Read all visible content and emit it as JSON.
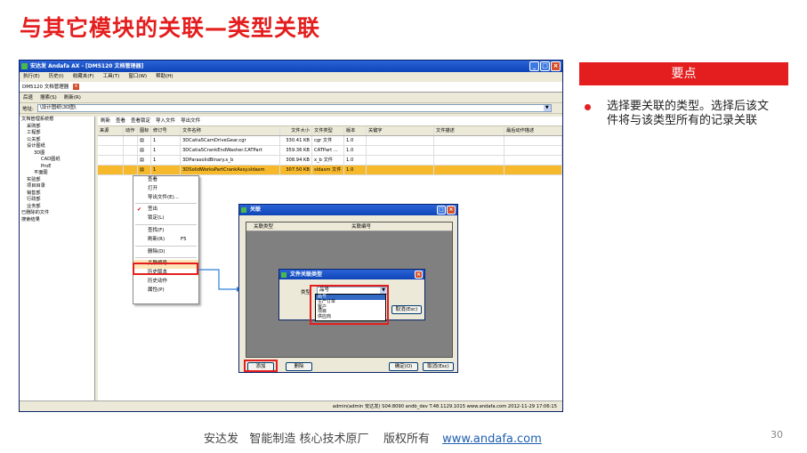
{
  "slide": {
    "title": "与其它模块的关联—类型关联",
    "key_header": "要点",
    "key_text": "选择要关联的类型。选择后该文件将与该类型所有的记录关联",
    "footer": "安达发   智能制造 核心技术原厂    版权所有",
    "footer_link": "www.andafa.com",
    "page_number": "30",
    "accent_color": "#e41e1e"
  },
  "window": {
    "title": "安达发 Andafa AX - [DM5120 文档管理器]",
    "menu": [
      "执行(E)",
      "历史(I)",
      "收藏夹(F)",
      "工具(T)",
      "窗口(W)",
      "帮助(H)"
    ],
    "doc_tab": "DM5120 文档管理器",
    "toolbar": [
      "后退",
      "搜索(S)",
      "刷新(R)"
    ],
    "address_label": "地址:",
    "address_value": "\\设计图纸\\3D图\\",
    "tree": [
      "文档管理系统根",
      "采购部",
      "工程部",
      "公关部",
      "设计图纸",
      "3D图",
      "CAD图纸",
      "ProE",
      "平面图",
      "实验部",
      "项目目录",
      "销售部",
      "行政部",
      "业务部",
      "已删除的文件",
      "搜索结果"
    ],
    "grid_toolbar": [
      "刷新",
      "查看",
      "查看锁定",
      "导入文件",
      "导出文件"
    ],
    "columns": [
      "来源",
      "动作",
      "图标",
      "修订号",
      "文件名称",
      "文件大小",
      "文件类型",
      "版本",
      "关键字",
      "文件描述",
      "最后动作描述"
    ],
    "rows": [
      {
        "rev": "1",
        "name": "3DCatia5CamDriveGear.cgr",
        "size": "330.41 KB",
        "type": "cgr 文件",
        "ver": "1.0"
      },
      {
        "rev": "1",
        "name": "3DCatia5CrankEndWasher.CATPart",
        "size": "359.36 KB",
        "type": "CATPart ...",
        "ver": "1.0"
      },
      {
        "rev": "1",
        "name": "3DParasolidBinary.x_b",
        "size": "308.94 KB",
        "type": "x_b 文件",
        "ver": "1.0"
      },
      {
        "rev": "1",
        "name": "3DSolidWorksPartCrankAssy.sldasm",
        "size": "307.50 KB",
        "type": "sldasm 文件",
        "ver": "1.0"
      }
    ],
    "status": "admin(admin 安达发)   S04:8090   andb_dev   T.48.1129.1015   www.andafa.com   2012-11-29 17:06:15"
  },
  "context_menu": {
    "items": [
      "查看",
      "打开",
      "导出文件(E)...",
      "签出",
      "锁定(L)",
      "查找(F)",
      "刷新(R)",
      "删除(D)",
      "关联编号",
      "历史版本",
      "历史动作",
      "属性(P)"
    ],
    "refresh_shortcut": "F5"
  },
  "link_dialog": {
    "title": "关联",
    "columns": [
      "关联类型",
      "关联编号"
    ],
    "add_button": "添加",
    "delete_button": "删除",
    "ok_button": "确定(O)",
    "cancel_button": "取消(Esc)"
  },
  "type_dialog": {
    "title": "文件关联类型",
    "label": "类型",
    "selected": "品号",
    "options": [
      "品号",
      "生产订单",
      "客户",
      "项目",
      "供应商"
    ],
    "cancel_button": "取消(Esc)"
  }
}
